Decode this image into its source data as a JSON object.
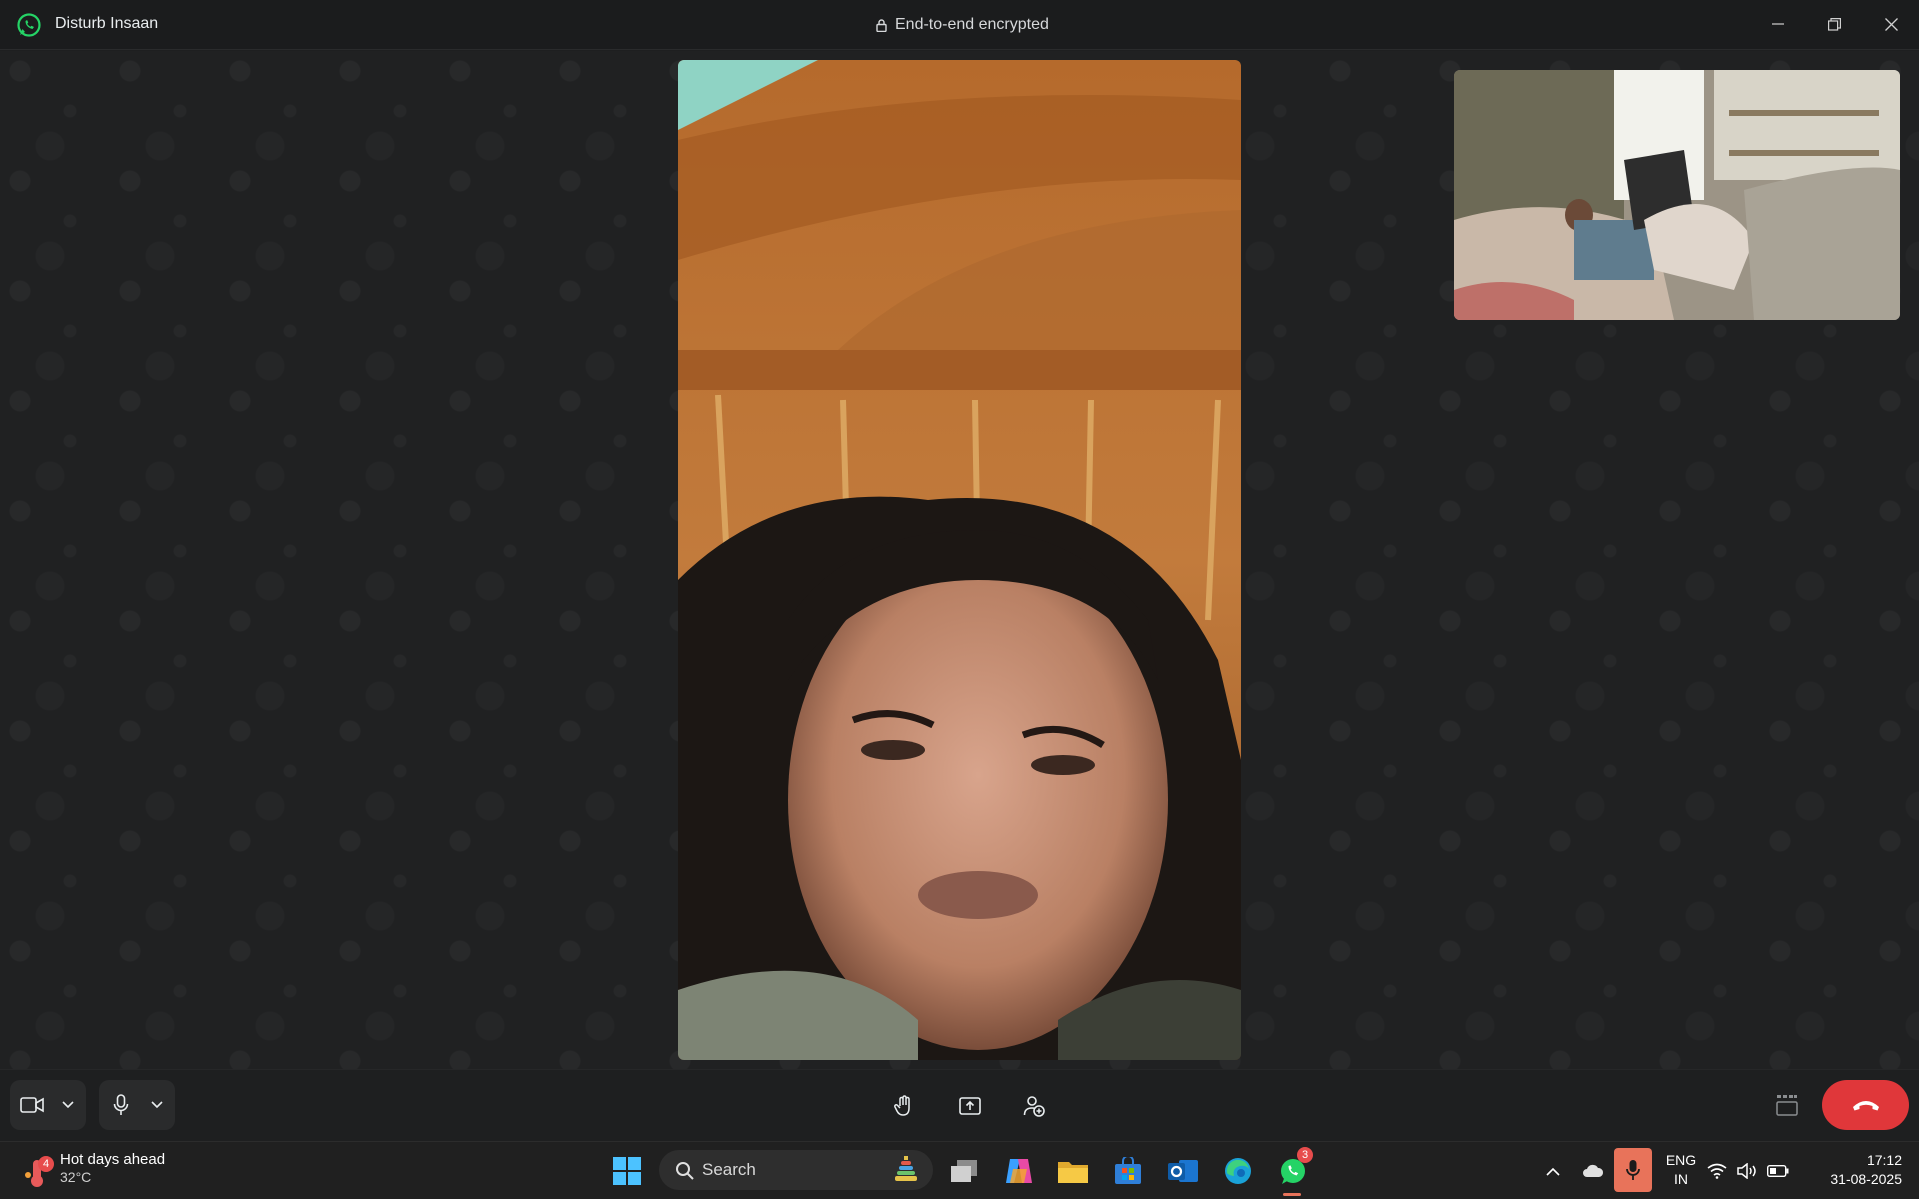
{
  "app": {
    "title": "Disturb Insaan",
    "encryption_label": "End-to-end encrypted"
  },
  "window_controls": [
    "minimize-icon",
    "restore-icon",
    "close-icon"
  ],
  "call": {
    "main_video": "remote participant video feed",
    "self_view": "local camera preview",
    "controls": {
      "camera": "video-camera-icon",
      "mic": "microphone-icon",
      "center": [
        "raise-hand-icon",
        "share-screen-icon",
        "add-person-icon"
      ],
      "layout": "layout-grid-icon",
      "end_call": "end-call-icon"
    }
  },
  "taskbar": {
    "weather": {
      "badge": "4",
      "text": "Hot days ahead",
      "temp": "32°C"
    },
    "search_label": "Search",
    "apps": [
      "windows-start-icon",
      "task-view-icon",
      "copilot-icon",
      "file-explorer-icon",
      "microsoft-store-icon",
      "outlook-icon",
      "edge-icon",
      "whatsapp-icon"
    ],
    "whatsapp_badge": "3",
    "tray": {
      "language_1": "ENG",
      "language_2": "IN",
      "time": "17:12",
      "date": "31-08-2025"
    }
  },
  "colors": {
    "end_call": "#e0373a",
    "whatsapp": "#25d366",
    "mic_active": "#e8735a"
  }
}
